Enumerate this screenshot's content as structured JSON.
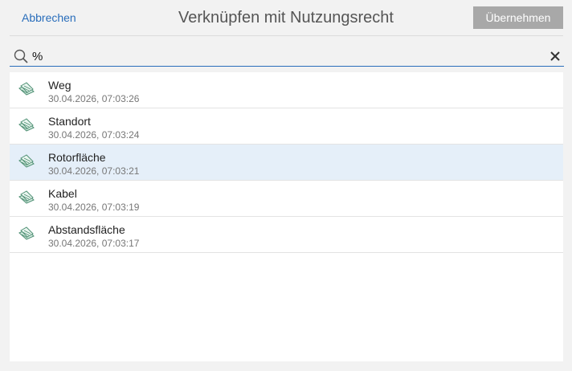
{
  "header": {
    "cancel_label": "Abbrechen",
    "title": "Verknüpfen mit Nutzungsrecht",
    "apply_label": "Übernehmen"
  },
  "search": {
    "value": "%"
  },
  "icons": {
    "search": "search-icon",
    "clear": "close-icon",
    "item": "map-parcel-icon"
  },
  "colors": {
    "accent": "#2a6ebb",
    "selected_row": "#e5eff9",
    "apply_button_disabled": "#a8a8a8"
  },
  "list": {
    "items": [
      {
        "name": "Weg",
        "date": "30.04.2026, 07:03:26",
        "selected": false
      },
      {
        "name": "Standort",
        "date": "30.04.2026, 07:03:24",
        "selected": false
      },
      {
        "name": "Rotorfläche",
        "date": "30.04.2026, 07:03:21",
        "selected": true
      },
      {
        "name": "Kabel",
        "date": "30.04.2026, 07:03:19",
        "selected": false
      },
      {
        "name": "Abstandsfläche",
        "date": "30.04.2026, 07:03:17",
        "selected": false
      }
    ]
  }
}
